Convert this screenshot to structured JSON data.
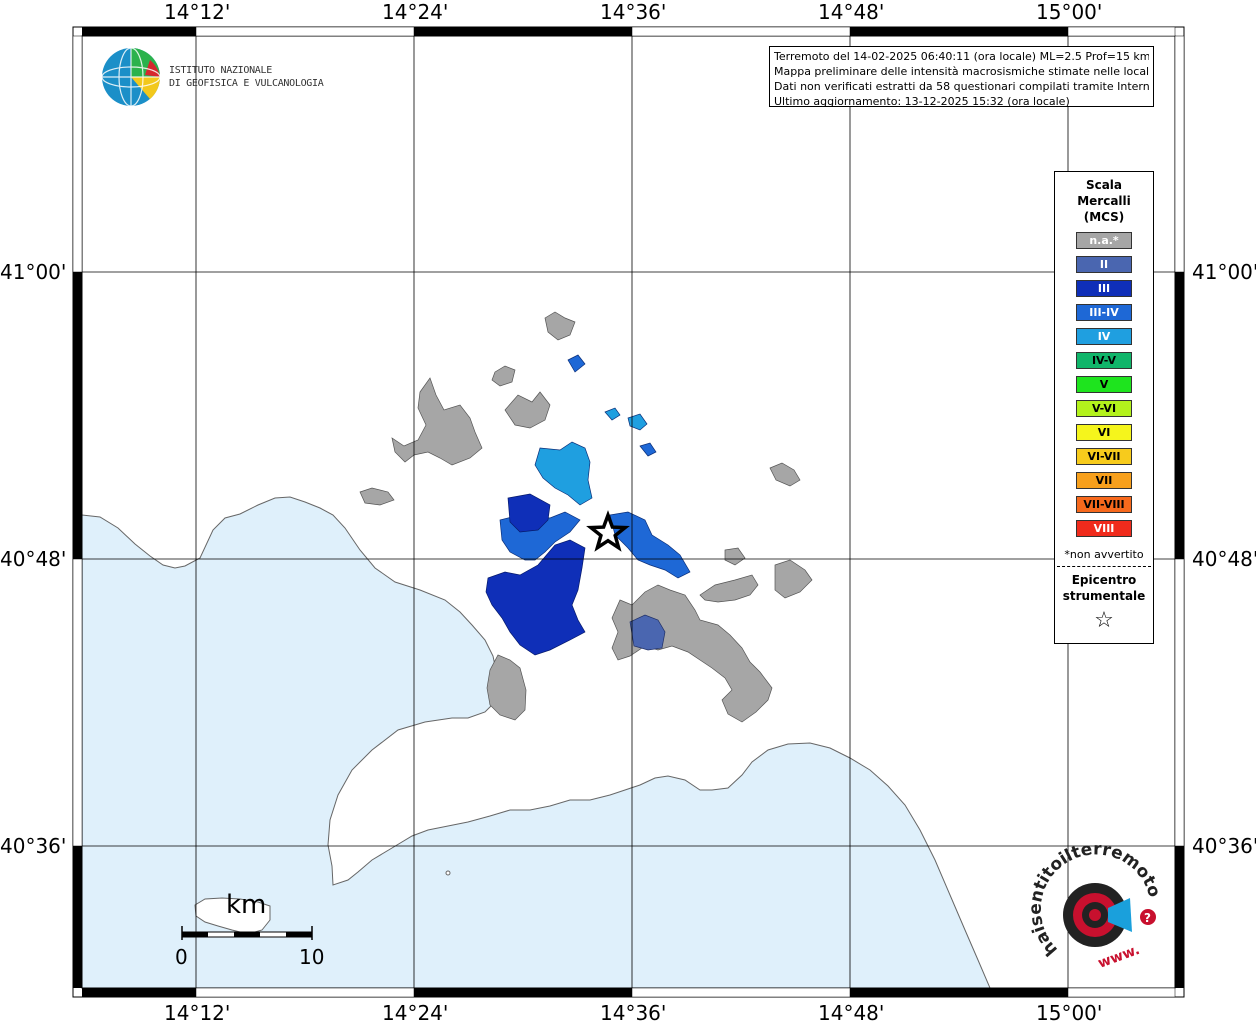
{
  "map": {
    "lon_labels": [
      "14°12'",
      "14°24'",
      "14°36'",
      "14°48'",
      "15°00'"
    ],
    "lat_labels": [
      "41°00'",
      "40°48'",
      "40°36'"
    ],
    "colors": {
      "sea": "#dff0fb",
      "land": "#ffffff",
      "na_fill": "#a6a6a6",
      "coast": "#666666"
    }
  },
  "info": {
    "line1": "Terremoto del 14-02-2025 06:40:11 (ora locale) ML=2.5 Prof=15 km",
    "line2": "Mappa preliminare delle intensità macrosismiche stimate nelle località",
    "line3": "Dati non verificati estratti da 58 questionari compilati tramite Internet.",
    "line4": "Ultimo aggiornamento: 13-12-2025 15:32 (ora locale)"
  },
  "logo": {
    "line1": "ISTITUTO NAZIONALE",
    "line2": "DI GEOFISICA E VULCANOLOGIA"
  },
  "legend": {
    "title_lines": [
      "Scala",
      "Mercalli",
      "(MCS)"
    ],
    "items": [
      {
        "label": "n.a.*",
        "color": "#a6a6a6",
        "dark": false
      },
      {
        "label": "II",
        "color": "#4a66b0",
        "dark": false
      },
      {
        "label": "III",
        "color": "#0f2fb8",
        "dark": false
      },
      {
        "label": "III-IV",
        "color": "#1e68d6",
        "dark": false
      },
      {
        "label": "IV",
        "color": "#1f9fe0",
        "dark": false
      },
      {
        "label": "IV-V",
        "color": "#10b56a",
        "dark": true
      },
      {
        "label": "V",
        "color": "#1ee41e",
        "dark": true
      },
      {
        "label": "V-VI",
        "color": "#b3f21c",
        "dark": true
      },
      {
        "label": "VI",
        "color": "#f5f51c",
        "dark": true
      },
      {
        "label": "VI-VII",
        "color": "#f7cb1c",
        "dark": true
      },
      {
        "label": "VII",
        "color": "#f7a01c",
        "dark": true
      },
      {
        "label": "VII-VIII",
        "color": "#f7691c",
        "dark": true
      },
      {
        "label": "VIII",
        "color": "#f02b1c",
        "dark": false
      }
    ],
    "note": "*non avvertito",
    "epicenter_lines": [
      "Epicentro",
      "strumentale"
    ],
    "epicenter_symbol": "☆"
  },
  "scalebar": {
    "title": "km",
    "start": "0",
    "end": "10"
  },
  "badge": {
    "arc_text": "haisentitoilterremoto.it",
    "url_text": "www.",
    "color": "#c8102e"
  },
  "epicenter": {
    "lon": 14.578,
    "lat": 40.818
  }
}
